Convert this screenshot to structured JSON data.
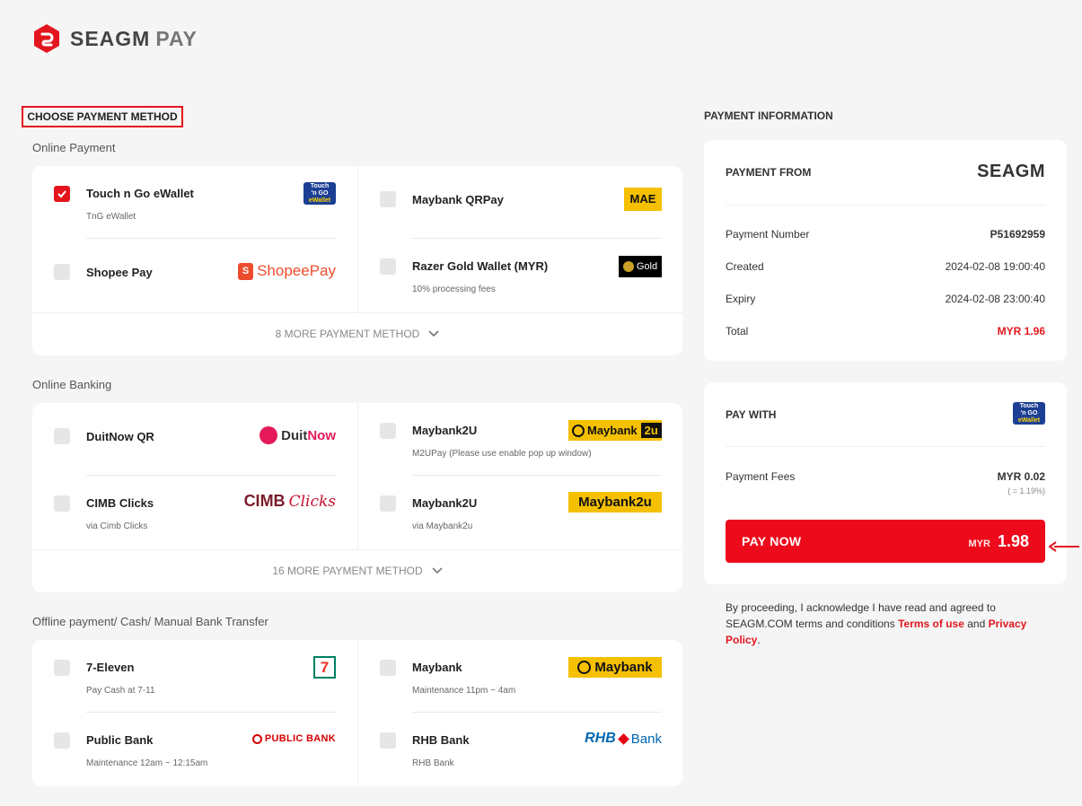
{
  "brand": {
    "name": "SEAGM",
    "pay": "PAY"
  },
  "left": {
    "title": "CHOOSE PAYMENT METHOD",
    "groups": [
      {
        "label": "Online Payment",
        "items": [
          {
            "name": "Touch n Go eWallet",
            "sub": "TnG eWallet",
            "checked": true,
            "logo": "touchngo-logo"
          },
          {
            "name": "Maybank QRPay",
            "sub": "",
            "checked": false,
            "logo": "mae-logo"
          },
          {
            "name": "Shopee Pay",
            "sub": "",
            "checked": false,
            "logo": "shopeepay-logo"
          },
          {
            "name": "Razer Gold Wallet (MYR)",
            "sub": "10% processing fees",
            "checked": false,
            "logo": "razer-gold-logo"
          }
        ],
        "more": "8 MORE PAYMENT METHOD"
      },
      {
        "label": "Online Banking",
        "items": [
          {
            "name": "DuitNow QR",
            "sub": "",
            "checked": false,
            "logo": "duitnow-logo"
          },
          {
            "name": "Maybank2U",
            "sub": "M2UPay (Please use enable pop up window)",
            "checked": false,
            "logo": "maybank2u-logo"
          },
          {
            "name": "CIMB Clicks",
            "sub": "via Cimb Clicks",
            "checked": false,
            "logo": "cimb-clicks-logo"
          },
          {
            "name": "Maybank2U",
            "sub": "via Maybank2u",
            "checked": false,
            "logo": "maybank2u-logo-alt"
          }
        ],
        "more": "16 MORE PAYMENT METHOD"
      },
      {
        "label": "Offline payment/ Cash/ Manual Bank Transfer",
        "items": [
          {
            "name": "7-Eleven",
            "sub": "Pay Cash at 7-11",
            "checked": false,
            "logo": "seven-eleven-logo"
          },
          {
            "name": "Maybank",
            "sub": "Maintenance 11pm ~ 4am",
            "checked": false,
            "logo": "maybank-logo"
          },
          {
            "name": "Public Bank",
            "sub": "Maintenance 12am ~ 12:15am",
            "checked": false,
            "logo": "public-bank-logo"
          },
          {
            "name": "RHB Bank",
            "sub": "RHB Bank",
            "checked": false,
            "logo": "rhb-bank-logo"
          }
        ]
      }
    ],
    "logos": {
      "touchngo": {
        "top": "Touch",
        "mid": "'n GO",
        "bot": "eWallet"
      },
      "mae": "MAE",
      "shopeepay": "ShopeePay",
      "razer": "Gold",
      "duitnow": {
        "a": "Duit",
        "b": "Now"
      },
      "maybank2u": {
        "a": "Maybank",
        "b": "2u"
      },
      "cimb": {
        "a": "CIMB",
        "b": "Clicks"
      },
      "maybank2u_alt": "Maybank2u",
      "seven": "7",
      "maybank": "Maybank",
      "publicbank": "PUBLIC BANK",
      "rhb": {
        "a": "RHB",
        "b": "Bank"
      }
    }
  },
  "right": {
    "title": "PAYMENT INFORMATION",
    "from_label": "PAYMENT FROM",
    "from_logo": "SEAGM",
    "rows": [
      {
        "label": "Payment Number",
        "value": "P51692959"
      },
      {
        "label": "Created",
        "value": "2024-02-08 19:00:40"
      },
      {
        "label": "Expiry",
        "value": "2024-02-08 23:00:40"
      },
      {
        "label": "Total",
        "value": "MYR 1.96"
      }
    ],
    "pay_with_label": "PAY WITH",
    "fees_label": "Payment Fees",
    "fees_value": "MYR 0.02",
    "fees_pct": "( = 1.19%)",
    "pay_button": {
      "label": "PAY NOW",
      "currency": "MYR",
      "amount": "1.98"
    },
    "terms": {
      "text1": "By proceeding, I acknowledge I have read and agreed to SEAGM.COM terms and conditions ",
      "link1": "Terms of use",
      "text2": " and ",
      "link2": "Privacy Policy",
      "text3": "."
    }
  },
  "colors": {
    "accent": "#e3161e",
    "button": "#ed0a1a",
    "maybank_yellow": "#f5c000"
  }
}
